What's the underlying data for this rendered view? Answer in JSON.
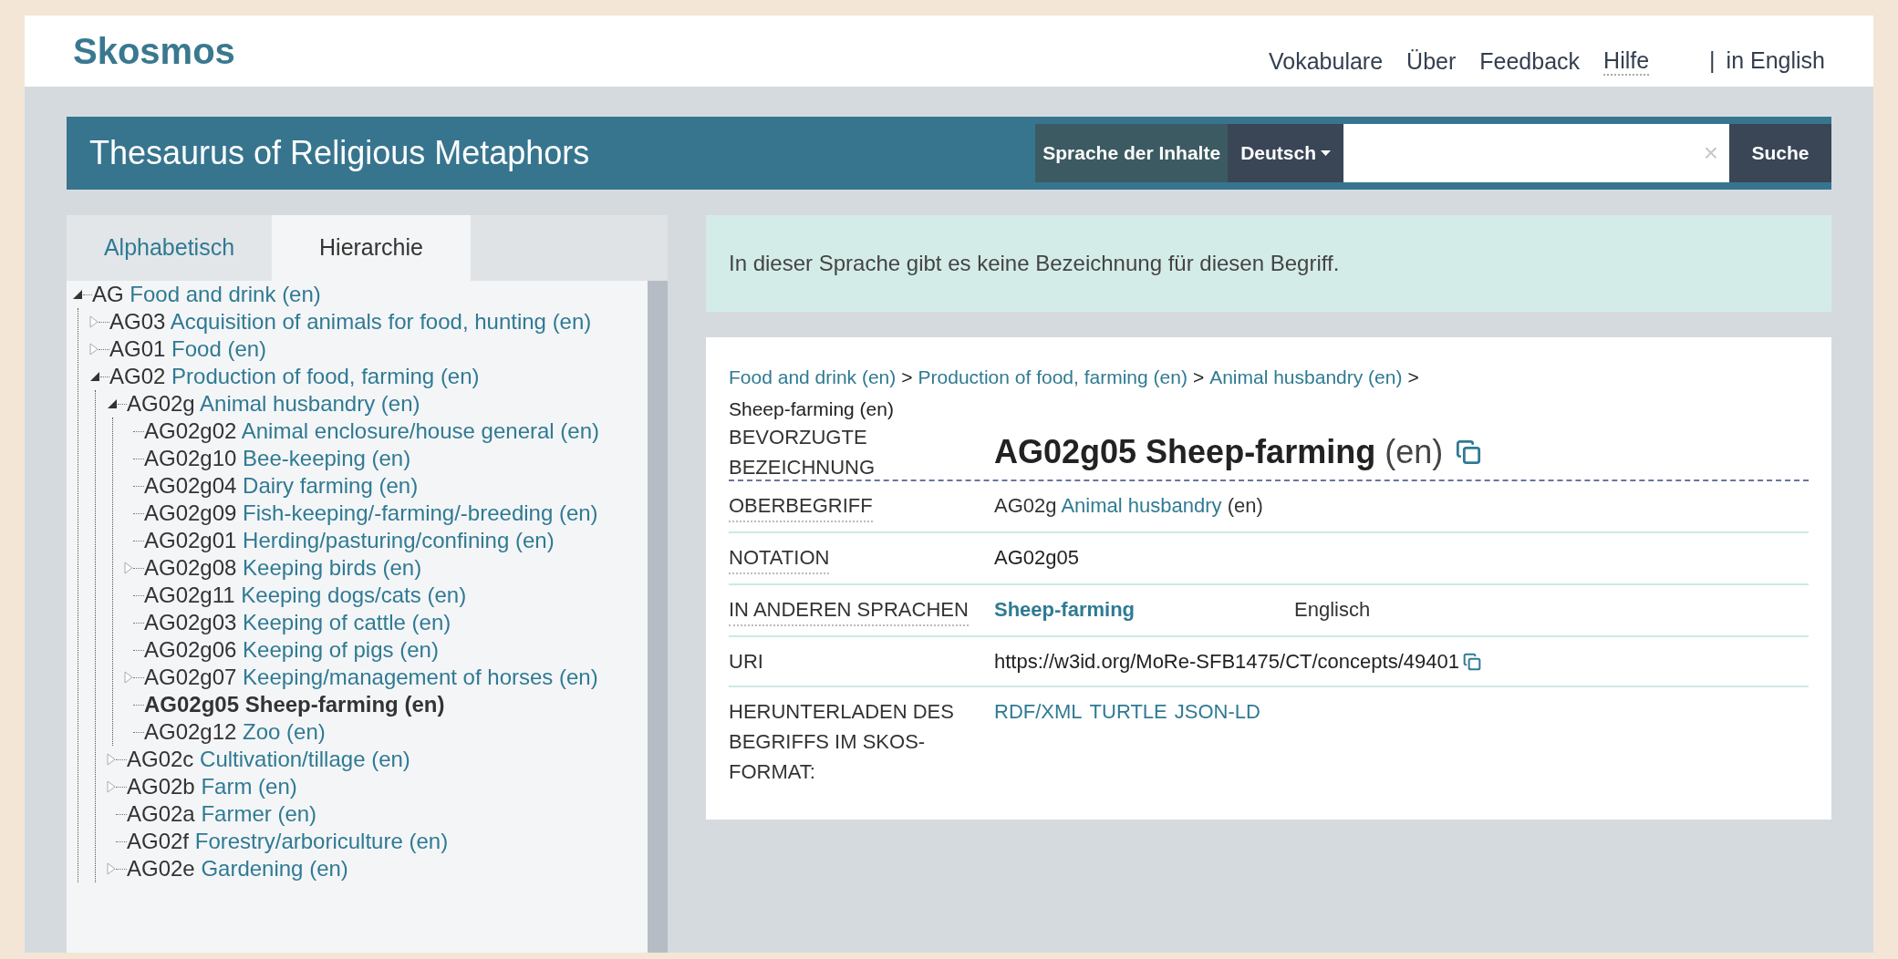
{
  "header": {
    "logo": "Skosmos",
    "nav": [
      {
        "label": "Vokabulare",
        "tooltip": false
      },
      {
        "label": "Über",
        "tooltip": false
      },
      {
        "label": "Feedback",
        "tooltip": false
      },
      {
        "label": "Hilfe",
        "tooltip": true
      }
    ],
    "separator": "|",
    "language_link": "in English"
  },
  "vocab_bar": {
    "title": "Thesaurus of Religious Metaphors",
    "content_language_label": "Sprache der Inhalte",
    "language": "Deutsch",
    "clear": "×",
    "search_button": "Suche"
  },
  "tabs": [
    {
      "label": "Alphabetisch",
      "selected": false
    },
    {
      "label": "Hierarchie",
      "selected": true
    }
  ],
  "tree": [
    {
      "notation": "AG",
      "label": "Food and drink (en)",
      "kind": "open",
      "selected": false,
      "children": [
        {
          "notation": "AG03",
          "label": "Acquisition of animals for food, hunting (en)",
          "kind": "closed",
          "selected": false
        },
        {
          "notation": "AG01",
          "label": "Food (en)",
          "kind": "closed",
          "selected": false
        },
        {
          "notation": "AG02",
          "label": "Production of food, farming (en)",
          "kind": "open",
          "selected": false,
          "children": [
            {
              "notation": "AG02g",
              "label": "Animal husbandry (en)",
              "kind": "open",
              "selected": false,
              "children": [
                {
                  "notation": "AG02g02",
                  "label": "Animal enclosure/house general (en)",
                  "kind": "leaf",
                  "selected": false
                },
                {
                  "notation": "AG02g10",
                  "label": "Bee-keeping (en)",
                  "kind": "leaf",
                  "selected": false
                },
                {
                  "notation": "AG02g04",
                  "label": "Dairy farming (en)",
                  "kind": "leaf",
                  "selected": false
                },
                {
                  "notation": "AG02g09",
                  "label": "Fish-keeping/-farming/-breeding (en)",
                  "kind": "leaf",
                  "selected": false
                },
                {
                  "notation": "AG02g01",
                  "label": "Herding/pasturing/confining (en)",
                  "kind": "leaf",
                  "selected": false
                },
                {
                  "notation": "AG02g08",
                  "label": "Keeping birds (en)",
                  "kind": "closed",
                  "selected": false
                },
                {
                  "notation": "AG02g11",
                  "label": "Keeping dogs/cats (en)",
                  "kind": "leaf",
                  "selected": false
                },
                {
                  "notation": "AG02g03",
                  "label": "Keeping of cattle (en)",
                  "kind": "leaf",
                  "selected": false
                },
                {
                  "notation": "AG02g06",
                  "label": "Keeping of pigs (en)",
                  "kind": "leaf",
                  "selected": false
                },
                {
                  "notation": "AG02g07",
                  "label": "Keeping/management of horses (en)",
                  "kind": "closed",
                  "selected": false
                },
                {
                  "notation": "AG02g05",
                  "label": "Sheep-farming (en)",
                  "kind": "leaf",
                  "selected": true
                },
                {
                  "notation": "AG02g12",
                  "label": "Zoo (en)",
                  "kind": "leaf",
                  "selected": false
                }
              ]
            },
            {
              "notation": "AG02c",
              "label": "Cultivation/tillage (en)",
              "kind": "closed",
              "selected": false
            },
            {
              "notation": "AG02b",
              "label": "Farm (en)",
              "kind": "closed",
              "selected": false
            },
            {
              "notation": "AG02a",
              "label": "Farmer (en)",
              "kind": "leaf",
              "selected": false
            },
            {
              "notation": "AG02f",
              "label": "Forestry/arboriculture (en)",
              "kind": "leaf",
              "selected": false
            },
            {
              "notation": "AG02e",
              "label": "Gardening (en)",
              "kind": "closed",
              "selected": false
            }
          ]
        }
      ]
    }
  ],
  "alert": "In dieser Sprache gibt es keine Bezeichnung für diesen Begriff.",
  "concept": {
    "breadcrumb": [
      {
        "label": "Food and drink (en)",
        "separator": ">"
      },
      {
        "label": "Production of food, farming (en)",
        "separator": ">"
      },
      {
        "label": "Animal husbandry (en)",
        "separator": ">"
      }
    ],
    "current": "Sheep-farming (en)",
    "preferred": {
      "label": "BEVORZUGTE BEZEICHNUNG",
      "notation": "AG02g05",
      "term": "Sheep-farming",
      "lang": "(en)"
    },
    "properties": [
      {
        "kind": "broader",
        "label": "OBERBEGRIFF",
        "tooltip": true,
        "notation": "AG02g",
        "link": "Animal husbandry",
        "lang": "(en)"
      },
      {
        "kind": "text",
        "label": "NOTATION",
        "tooltip": true,
        "value": "AG02g05"
      },
      {
        "kind": "languages",
        "label": "IN ANDEREN SPRACHEN",
        "tooltip": true,
        "term": "Sheep-farming",
        "language": "Englisch"
      },
      {
        "kind": "uri",
        "label": "URI",
        "tooltip": false,
        "value": "https://w3id.org/MoRe-SFB1475/CT/concepts/49401"
      },
      {
        "kind": "downloads",
        "label": "HERUNTERLADEN DES BEGRIFFS IM SKOS-FORMAT:",
        "tooltip": false,
        "links": [
          "RDF/XML",
          "TURTLE",
          "JSON-LD"
        ]
      }
    ]
  }
}
